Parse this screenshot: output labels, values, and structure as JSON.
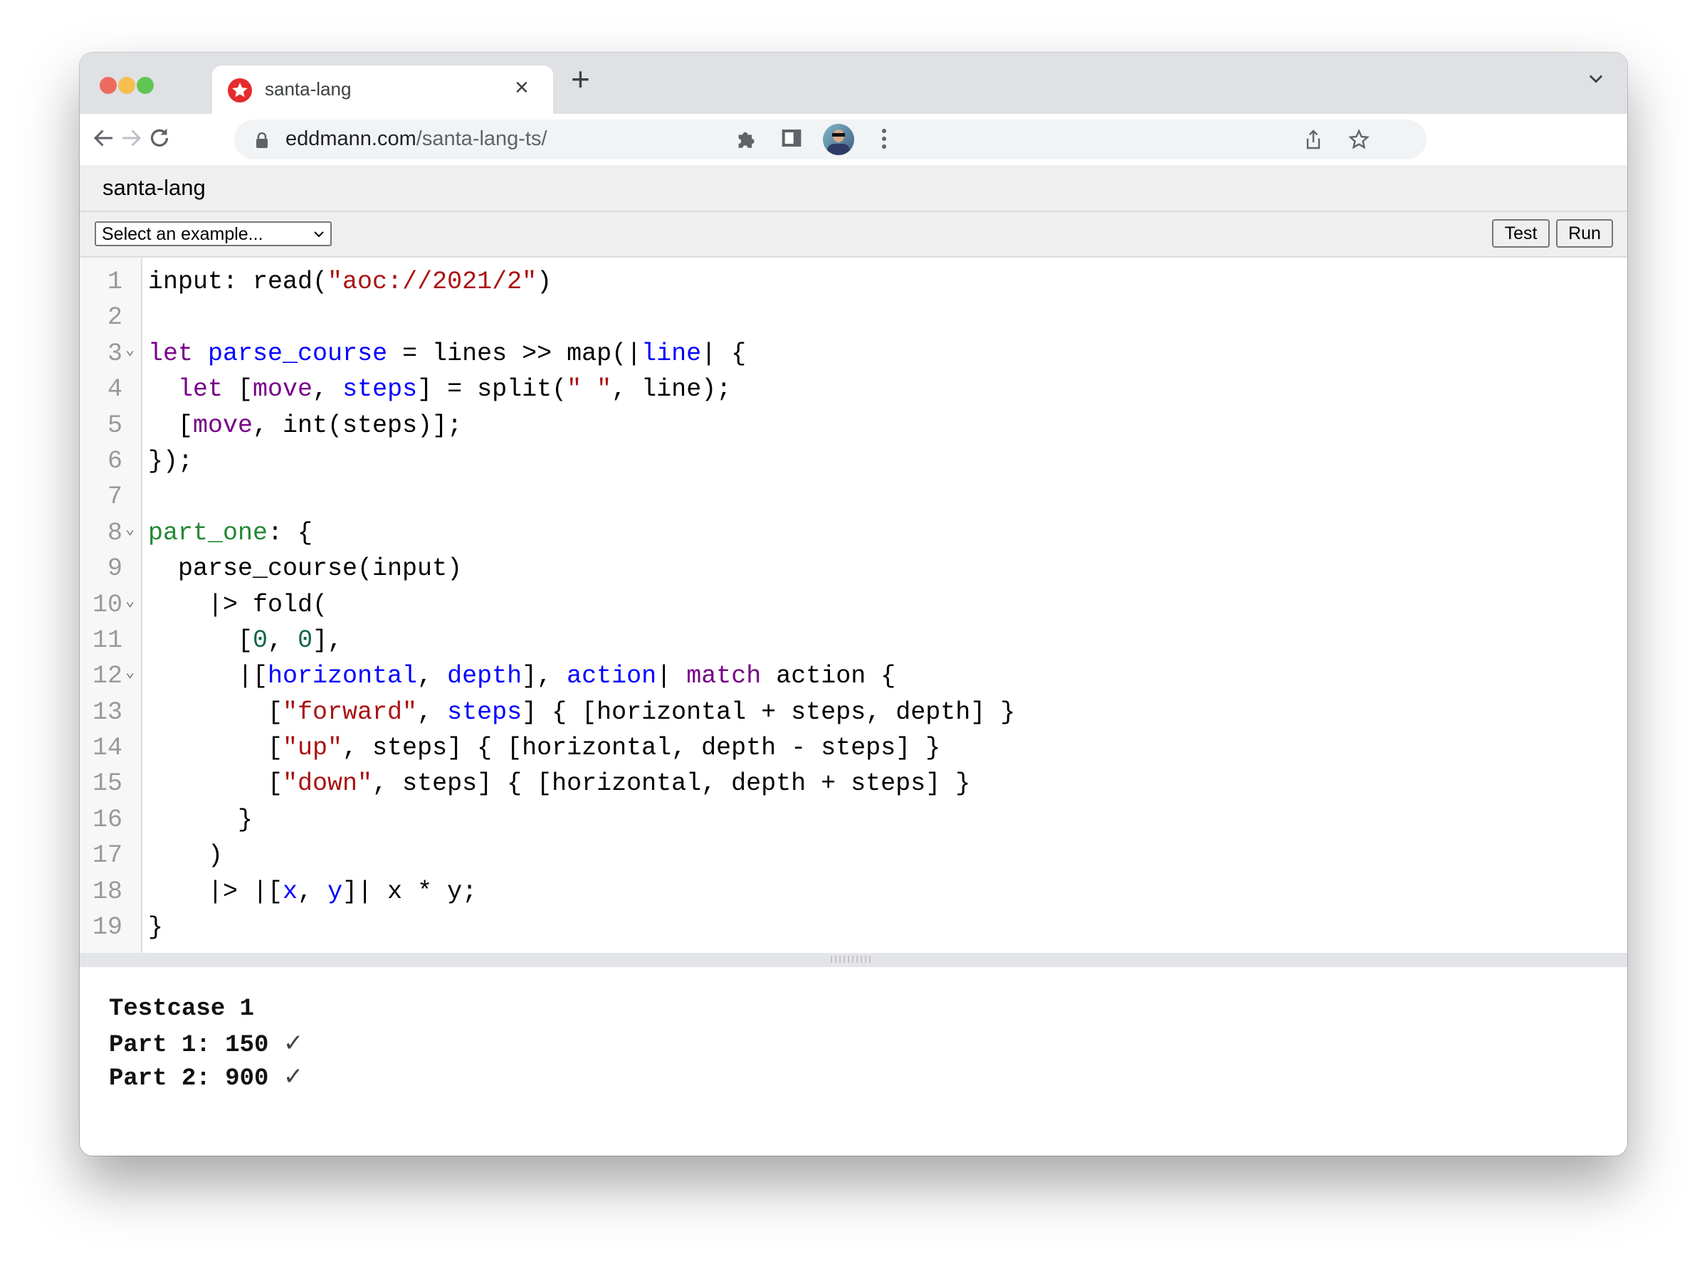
{
  "browser": {
    "tab_title": "santa-lang",
    "tab_close": "×",
    "new_tab": "+",
    "url_host": "eddmann.com",
    "url_path": "/santa-lang-ts/"
  },
  "colors": {
    "keyword": "#770088",
    "definition": "#0000ff",
    "string": "#aa1111",
    "number": "#116644",
    "property": "#228833"
  },
  "page": {
    "title": "santa-lang",
    "example_select": "Select an example...",
    "test_label": "Test",
    "run_label": "Run"
  },
  "editor": {
    "lines": [
      {
        "n": "1",
        "fold": false,
        "tokens": [
          [
            "input: read(",
            ""
          ],
          [
            "\"aoc://2021/2\"",
            "str"
          ],
          [
            ")",
            ""
          ]
        ]
      },
      {
        "n": "2",
        "fold": false,
        "tokens": []
      },
      {
        "n": "3",
        "fold": true,
        "tokens": [
          [
            "let",
            "kw"
          ],
          [
            " ",
            ""
          ],
          [
            "parse_course",
            "def"
          ],
          [
            " = lines >> map(|",
            ""
          ],
          [
            "line",
            "def"
          ],
          [
            "| {",
            ""
          ]
        ]
      },
      {
        "n": "4",
        "fold": false,
        "tokens": [
          [
            "  ",
            ""
          ],
          [
            "let",
            "kw"
          ],
          [
            " [",
            ""
          ],
          [
            "move",
            "kw"
          ],
          [
            ", ",
            ""
          ],
          [
            "steps",
            "def"
          ],
          [
            "] = split(",
            ""
          ],
          [
            "\" \"",
            "str"
          ],
          [
            ", line);",
            ""
          ]
        ]
      },
      {
        "n": "5",
        "fold": false,
        "tokens": [
          [
            "  [",
            ""
          ],
          [
            "move",
            "kw"
          ],
          [
            ", int(steps)];",
            ""
          ]
        ]
      },
      {
        "n": "6",
        "fold": false,
        "tokens": [
          [
            "});",
            ""
          ]
        ]
      },
      {
        "n": "7",
        "fold": false,
        "tokens": []
      },
      {
        "n": "8",
        "fold": true,
        "tokens": [
          [
            "part_one",
            "prop"
          ],
          [
            ": {",
            ""
          ]
        ]
      },
      {
        "n": "9",
        "fold": false,
        "tokens": [
          [
            "  parse_course(input)",
            ""
          ]
        ]
      },
      {
        "n": "10",
        "fold": true,
        "tokens": [
          [
            "    |> fold(",
            ""
          ]
        ]
      },
      {
        "n": "11",
        "fold": false,
        "tokens": [
          [
            "      [",
            ""
          ],
          [
            "0",
            "num"
          ],
          [
            ", ",
            ""
          ],
          [
            "0",
            "num"
          ],
          [
            "],",
            ""
          ]
        ]
      },
      {
        "n": "12",
        "fold": true,
        "tokens": [
          [
            "      |[",
            ""
          ],
          [
            "horizontal",
            "def"
          ],
          [
            ", ",
            ""
          ],
          [
            "depth",
            "def"
          ],
          [
            "], ",
            ""
          ],
          [
            "action",
            "def"
          ],
          [
            "| ",
            ""
          ],
          [
            "match",
            "kw"
          ],
          [
            " action {",
            ""
          ]
        ]
      },
      {
        "n": "13",
        "fold": false,
        "tokens": [
          [
            "        [",
            ""
          ],
          [
            "\"forward\"",
            "str"
          ],
          [
            ", ",
            ""
          ],
          [
            "steps",
            "def"
          ],
          [
            "] { [horizontal + steps, depth] }",
            ""
          ]
        ]
      },
      {
        "n": "14",
        "fold": false,
        "tokens": [
          [
            "        [",
            ""
          ],
          [
            "\"up\"",
            "str"
          ],
          [
            ", steps] { [horizontal, depth - steps] }",
            ""
          ]
        ]
      },
      {
        "n": "15",
        "fold": false,
        "tokens": [
          [
            "        [",
            ""
          ],
          [
            "\"down\"",
            "str"
          ],
          [
            ", steps] { [horizontal, depth + steps] }",
            ""
          ]
        ]
      },
      {
        "n": "16",
        "fold": false,
        "tokens": [
          [
            "      }",
            ""
          ]
        ]
      },
      {
        "n": "17",
        "fold": false,
        "tokens": [
          [
            "    )",
            ""
          ]
        ]
      },
      {
        "n": "18",
        "fold": false,
        "tokens": [
          [
            "    |> |[",
            ""
          ],
          [
            "x",
            "def"
          ],
          [
            ", ",
            ""
          ],
          [
            "y",
            "def"
          ],
          [
            "]| x * y;",
            ""
          ]
        ]
      },
      {
        "n": "19",
        "fold": false,
        "tokens": [
          [
            "}",
            ""
          ]
        ]
      }
    ]
  },
  "output": {
    "testcase": "Testcase 1",
    "part1": "Part 1: 150",
    "part2": "Part 2: 900",
    "check": "✓"
  }
}
